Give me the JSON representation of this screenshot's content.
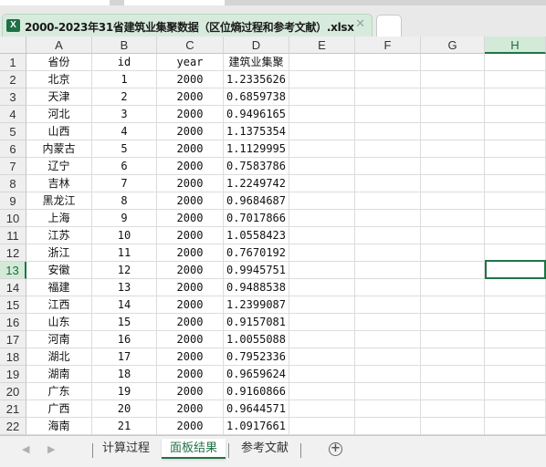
{
  "file_tab": {
    "icon_letter": "X",
    "title": "2000-2023年31省建筑业集聚数据（区位熵过程和参考文献）.xlsx",
    "close": "✕"
  },
  "columns": [
    "A",
    "B",
    "C",
    "D",
    "E",
    "F",
    "G",
    "H"
  ],
  "selected_column": "H",
  "selected_row": 13,
  "header_row": [
    "省份",
    "id",
    "year",
    "建筑业集聚"
  ],
  "rows": [
    [
      "北京",
      "1",
      "2000",
      "1.2335626"
    ],
    [
      "天津",
      "2",
      "2000",
      "0.6859738"
    ],
    [
      "河北",
      "3",
      "2000",
      "0.9496165"
    ],
    [
      "山西",
      "4",
      "2000",
      "1.1375354"
    ],
    [
      "内蒙古",
      "5",
      "2000",
      "1.1129995"
    ],
    [
      "辽宁",
      "6",
      "2000",
      "0.7583786"
    ],
    [
      "吉林",
      "7",
      "2000",
      "1.2249742"
    ],
    [
      "黑龙江",
      "8",
      "2000",
      "0.9684687"
    ],
    [
      "上海",
      "9",
      "2000",
      "0.7017866"
    ],
    [
      "江苏",
      "10",
      "2000",
      "1.0558423"
    ],
    [
      "浙江",
      "11",
      "2000",
      "0.7670192"
    ],
    [
      "安徽",
      "12",
      "2000",
      "0.9945751"
    ],
    [
      "福建",
      "13",
      "2000",
      "0.9488538"
    ],
    [
      "江西",
      "14",
      "2000",
      "1.2399087"
    ],
    [
      "山东",
      "15",
      "2000",
      "0.9157081"
    ],
    [
      "河南",
      "16",
      "2000",
      "1.0055088"
    ],
    [
      "湖北",
      "17",
      "2000",
      "0.7952336"
    ],
    [
      "湖南",
      "18",
      "2000",
      "0.9659624"
    ],
    [
      "广东",
      "19",
      "2000",
      "0.9160866"
    ],
    [
      "广西",
      "20",
      "2000",
      "0.9644571"
    ],
    [
      "海南",
      "21",
      "2000",
      "1.0917661"
    ]
  ],
  "row_numbers": [
    "1",
    "2",
    "3",
    "4",
    "5",
    "6",
    "7",
    "8",
    "9",
    "10",
    "11",
    "12",
    "13",
    "14",
    "15",
    "16",
    "17",
    "18",
    "19",
    "20",
    "21",
    "22"
  ],
  "sheets": [
    {
      "label": "计算过程",
      "active": false
    },
    {
      "label": "面板结果",
      "active": true
    },
    {
      "label": "参考文献",
      "active": false
    }
  ],
  "sheet_nav": {
    "prev": "◀",
    "next": "▶",
    "add": "+"
  },
  "colors": {
    "accent": "#217346"
  }
}
